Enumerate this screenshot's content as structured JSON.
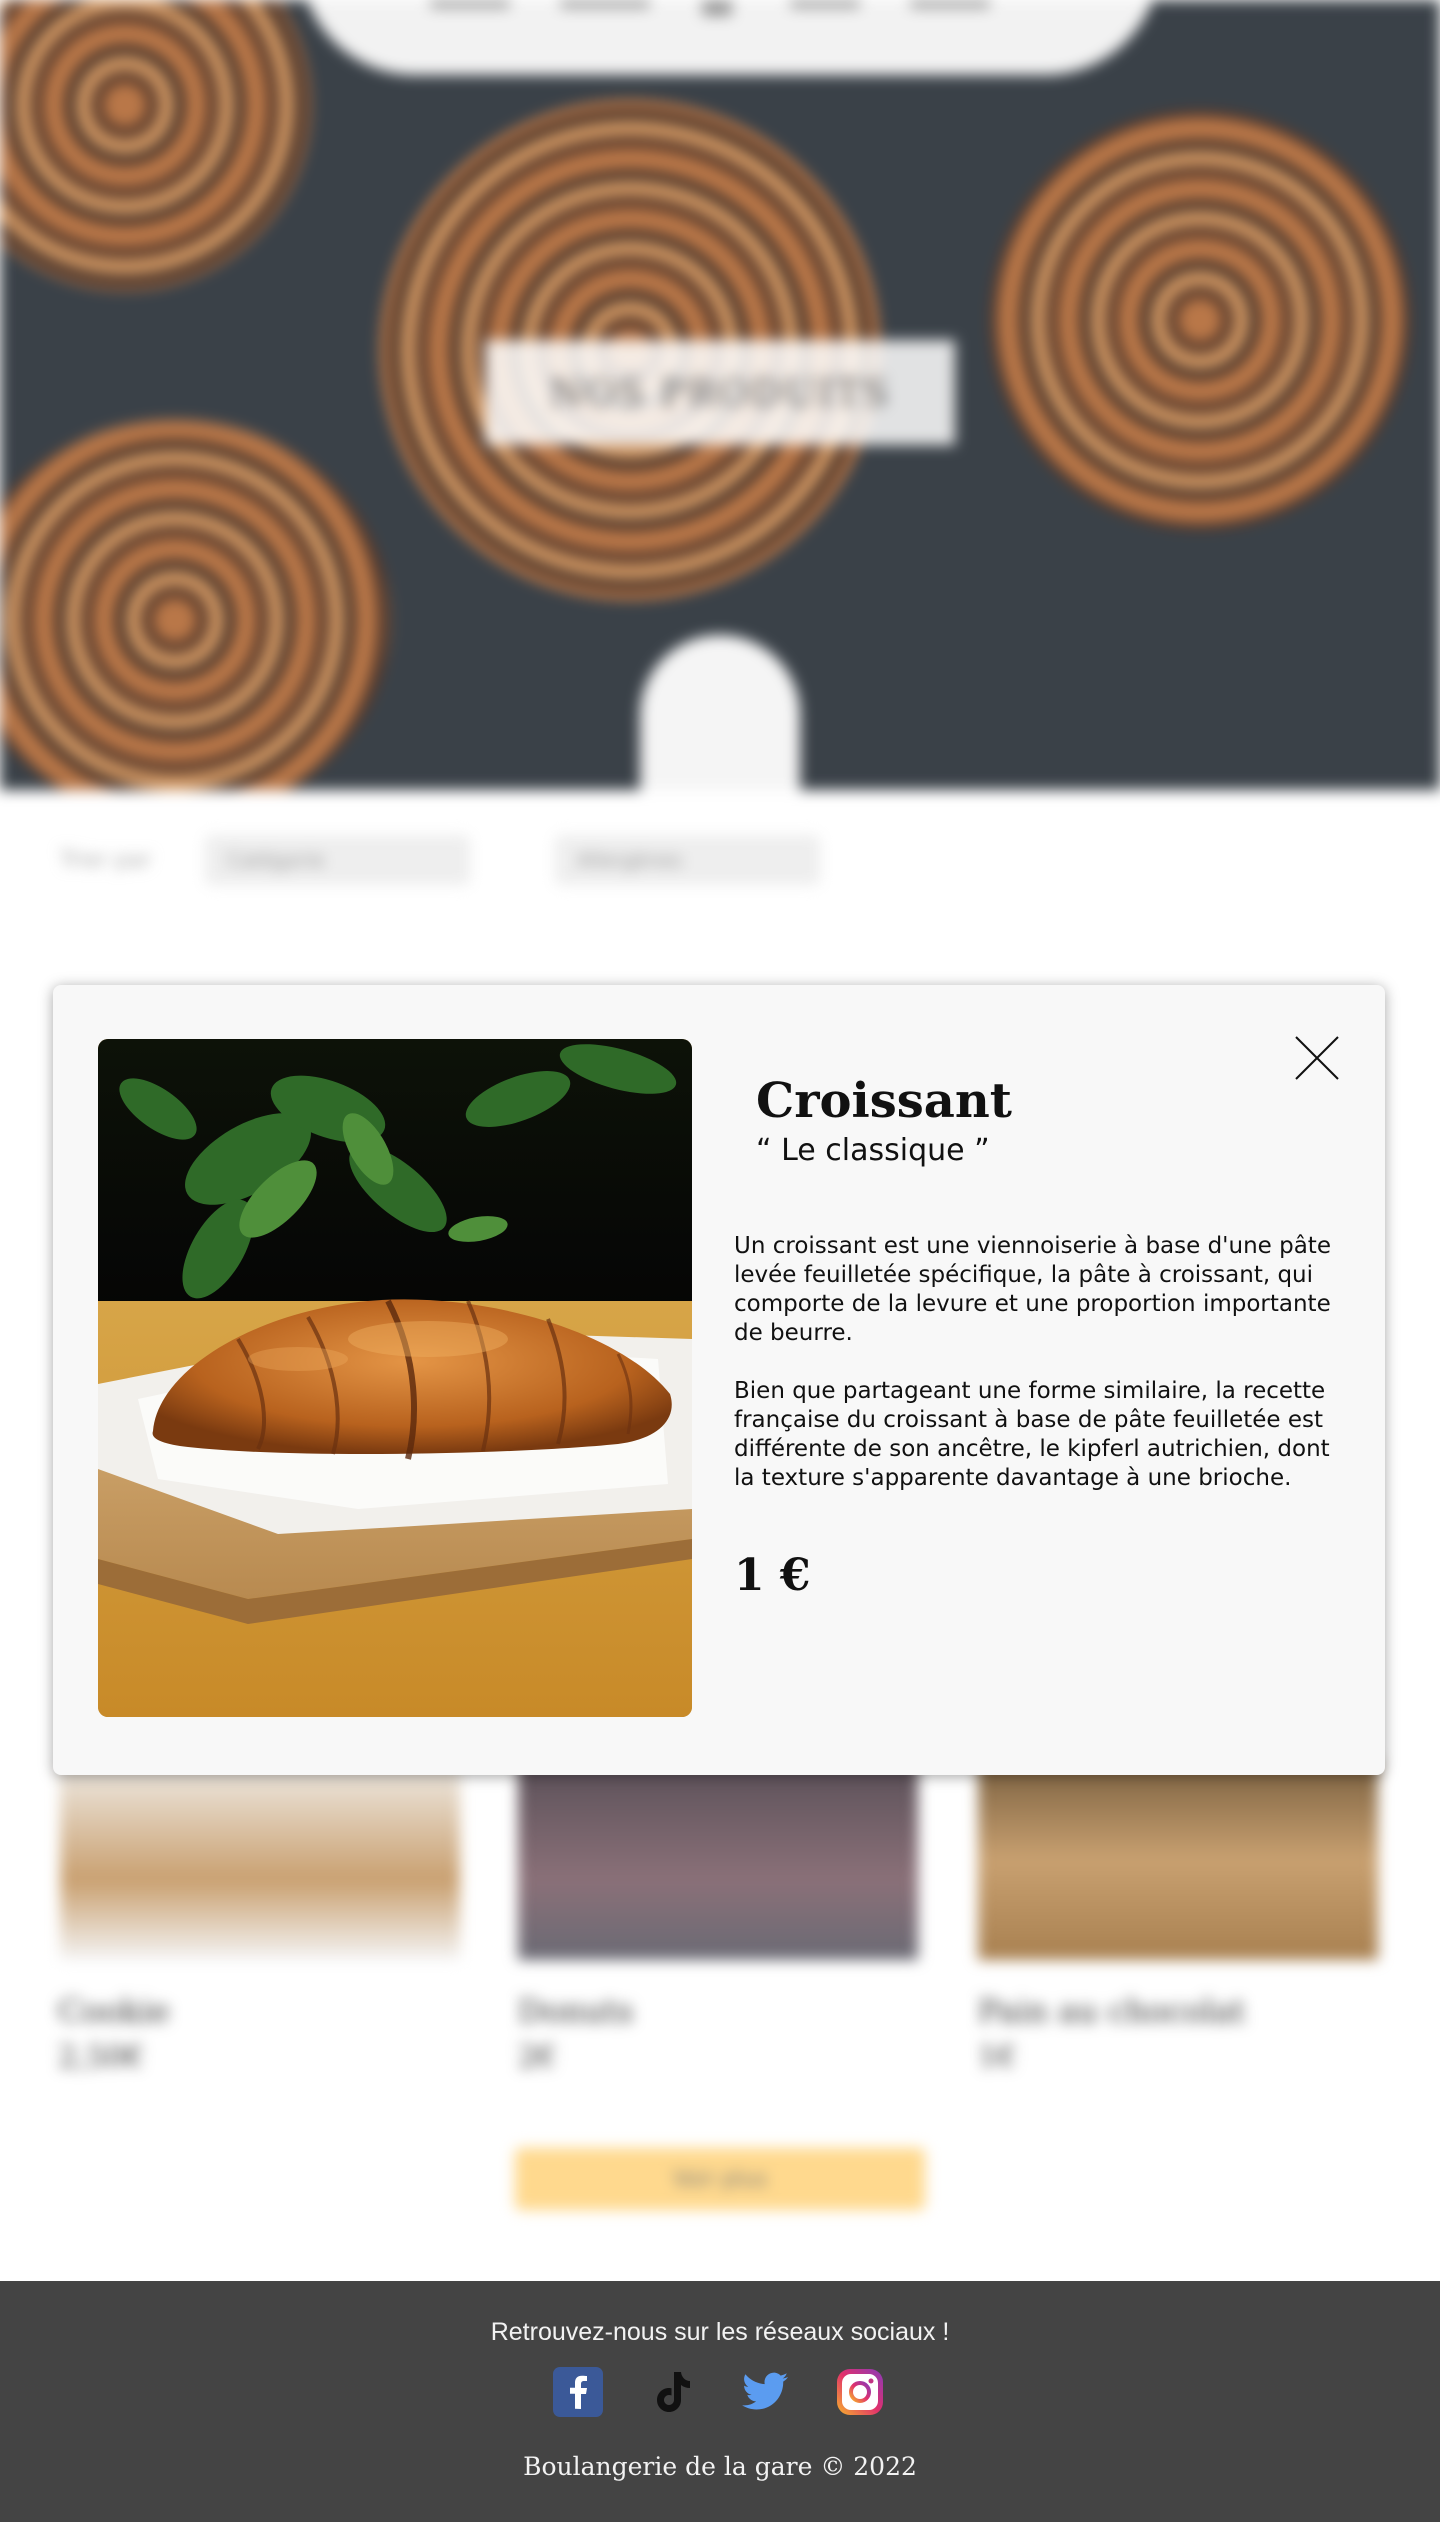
{
  "background_page": {
    "hero_title": "NOS PRODUITS",
    "filter_label": "Trier par",
    "filter_category": "Catégorie",
    "filter_allergens": "Allergènes",
    "products": [
      {
        "name": "Cookie",
        "price": "2,50€"
      },
      {
        "name": "Donuts",
        "price": "2€"
      },
      {
        "name": "Pain au chocolat",
        "price": "1€"
      }
    ],
    "more_button": "Voir plus"
  },
  "modal": {
    "title": "Croissant",
    "subtitle": "“ Le classique ”",
    "paragraph1": "Un croissant est une viennoiserie à base d'une pâte levée feuilletée spécifique, la pâte à croissant, qui comporte de la levure et une proportion importante de beurre.",
    "paragraph2": "Bien que partageant une forme similaire, la recette française du croissant à base de pâte feuilletée est différente de son ancêtre, le kipferl autrichien, dont la texture s'apparente davantage à une brioche.",
    "price": "1 €",
    "close_icon": "close-icon",
    "image_subject": "croissant"
  },
  "footer": {
    "social_text": "Retrouvez-nous sur les réseaux sociaux !",
    "social_icons": [
      "facebook-icon",
      "tiktok-icon",
      "twitter-icon",
      "instagram-icon"
    ],
    "copyright": "Boulangerie de la gare © 2022",
    "background_color": "#444444"
  }
}
